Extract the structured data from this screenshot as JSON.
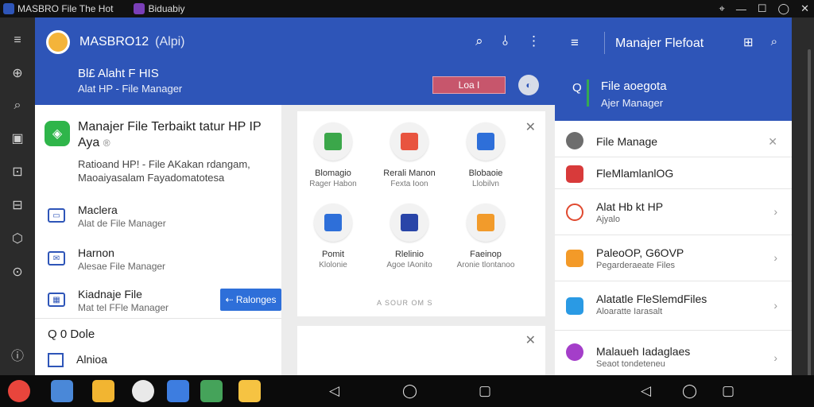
{
  "window": {
    "tab1_title": "MASBRO File The Hot",
    "tab2_title": "Biduabiy",
    "controls": [
      "⌖",
      "—",
      "☐",
      "◯",
      "✕"
    ]
  },
  "rail": {
    "icons": [
      "≡",
      "⊕",
      "⌕",
      "▣",
      "⊡",
      "⊟",
      "⬡",
      "⊙",
      "ⓘ"
    ]
  },
  "app": {
    "name": "MASBRO12",
    "name_sub": "(Alpi)",
    "header_line1": "Bl£ Alaht F HIS",
    "header_line2": "Alat HP - File Manager",
    "badge": "Loa I",
    "circle_label": "◐",
    "actions": [
      "⌕",
      "⫰",
      "⋮"
    ]
  },
  "left_card": {
    "app_icon": "◈",
    "title": "Manajer File Terbaikt tatur HP IP Aya",
    "title_suffix": "®",
    "description": "Ratioand HP! - File AKakan rdangam, Maoaiyasalam Fayadomatotesa",
    "items": [
      {
        "title": "Maclera",
        "subtitle": "Alat de File Manager",
        "icon": "▭"
      },
      {
        "title": "Harnon",
        "subtitle": "Alesae File Manager",
        "icon": "✉"
      },
      {
        "title": "Kiadnaje File",
        "subtitle": "Mat tel FFle Manager",
        "icon": "▦"
      }
    ],
    "button": "⇠ Ralonges",
    "search_label": "Q 0 Dole",
    "last_item": "Alnioa"
  },
  "grid_card": {
    "close": "✕",
    "cells": [
      {
        "title": "Blomagio",
        "subtitle": "Rager Habon",
        "color": "#3ba74a"
      },
      {
        "title": "Rerali Manon",
        "subtitle": "Fexta Ioon",
        "color": "#e8543f"
      },
      {
        "title": "Blobaoie",
        "subtitle": "Llobilvn",
        "color": "#2e6fd9"
      },
      {
        "title": "Pomit",
        "subtitle": "Klolonie",
        "color": "#2e6fd9"
      },
      {
        "title": "Rlelinio",
        "subtitle": "Agoe IAonito",
        "color": "#2945a8"
      },
      {
        "title": "Faeinop",
        "subtitle": "Aronie tlontanoo",
        "color": "#f29b2b"
      }
    ],
    "footer": "A SOUR OM S",
    "mini_close": "✕"
  },
  "right_panel": {
    "menu_icon": "≡",
    "title": "Manajer Flefoat",
    "actions": [
      "⊞",
      "⌕"
    ],
    "search_icon": "Q",
    "header_line1": "File aoegota",
    "header_line2": "Ajer Manager",
    "items": [
      {
        "title": "File Manage",
        "subtitle": "",
        "trailing": "✕",
        "icon_color": "#6d6d6d"
      },
      {
        "title": "FleMlamlanlOG",
        "subtitle": "",
        "trailing": "",
        "icon_color": "#d83a3a"
      },
      {
        "title": "Alat Hb kt HP",
        "subtitle": "Ajyalo",
        "trailing": "›",
        "icon_color": "#e0492f"
      },
      {
        "title": "PaleoOP, G6OVP",
        "subtitle": "Pegarderaeate Files",
        "trailing": "›",
        "icon_color": "#f39a28"
      },
      {
        "title": "Alatatle FleSlemdFiles",
        "subtitle": "Aloaratte Iarasalt",
        "trailing": "›",
        "icon_color": "#2a9ae4"
      },
      {
        "title": "Malaueh Iadaglaes",
        "subtitle": "Seaot tondeteneu",
        "trailing": "›",
        "icon_color": "#a43ec9"
      }
    ]
  },
  "taskbar": {
    "apps": [
      {
        "name": "chrome",
        "color": "#e8453c"
      },
      {
        "name": "files",
        "color": "#4a88d8"
      },
      {
        "name": "folder",
        "color": "#f2b531"
      },
      {
        "name": "camera",
        "color": "#e9e9e9"
      },
      {
        "name": "browser",
        "color": "#3d7de0"
      },
      {
        "name": "gallery",
        "color": "#45a35a"
      },
      {
        "name": "drive",
        "color": "#f6c342"
      }
    ],
    "nav": [
      "◁",
      "◯",
      "▢",
      "◁",
      "◯",
      "▢"
    ]
  }
}
